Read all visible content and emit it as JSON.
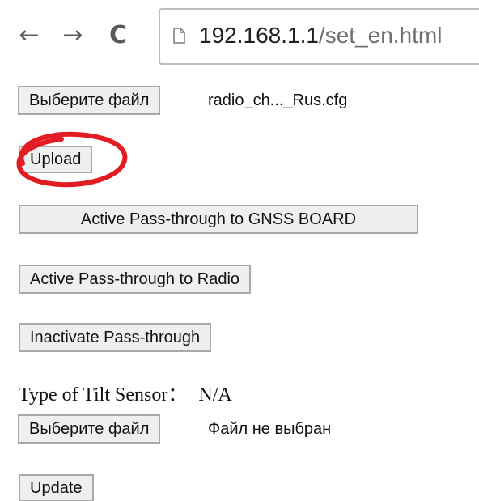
{
  "browser": {
    "back_glyph": "←",
    "forward_glyph": "→",
    "reload_glyph": "C",
    "url_host": "192.168.1.1",
    "url_path": "/set_en.html"
  },
  "config_upload": {
    "choose_file_label": "Выберите файл",
    "selected_file": "radio_ch..._Rus.cfg",
    "upload_label": "Upload",
    "highlight_color": "#e31b23"
  },
  "pass_through": {
    "gnss_label": "Active Pass-through to GNSS BOARD",
    "radio_label": "Active Pass-through to Radio",
    "inactivate_label": "Inactivate Pass-through"
  },
  "tilt_sensor": {
    "label": "Type of Tilt Sensor：",
    "value": "N/A",
    "choose_file_label": "Выберите файл",
    "selected_file": "Файл не выбран",
    "update_label": "Update"
  }
}
